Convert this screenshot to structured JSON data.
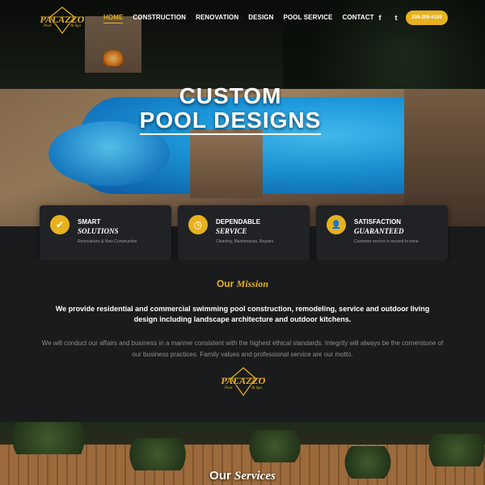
{
  "logo": {
    "name": "PALAZZO",
    "sub_left": "Pool",
    "sub_right": "& Spa"
  },
  "nav": {
    "items": [
      {
        "label": "HOME",
        "active": true
      },
      {
        "label": "CONSTRUCTION",
        "active": false
      },
      {
        "label": "RENOVATION",
        "active": false
      },
      {
        "label": "DESIGN",
        "active": false
      },
      {
        "label": "POOL SERVICE",
        "active": false
      },
      {
        "label": "CONTACT",
        "active": false
      }
    ],
    "social": [
      {
        "icon": "facebook-icon",
        "glyph": "f"
      },
      {
        "icon": "twitter-icon",
        "glyph": "t"
      }
    ],
    "phone": "239-205-6100"
  },
  "hero": {
    "line1": "CUSTOM",
    "line2": "POOL DESIGNS"
  },
  "features": [
    {
      "icon": "checkmark-icon",
      "glyph": "✔",
      "title": "SMART",
      "subtitle": "SOLUTIONS",
      "desc": "Renovations & New Construction"
    },
    {
      "icon": "clock-icon",
      "glyph": "◷",
      "title": "DEPENDABLE",
      "subtitle": "SERVICE",
      "desc": "Cleaning, Maintenance, Repairs."
    },
    {
      "icon": "user-plus-icon",
      "glyph": "👤",
      "title": "SATISFACTION",
      "subtitle": "GUARANTEED",
      "desc": "Customer service is second to none."
    }
  ],
  "mission": {
    "title_plain": "Our",
    "title_italic": "Mission",
    "lead": "We provide residential and commercial swimming pool construction, remodeling, service and outdoor living design including landscape architecture and outdoor kitchens.",
    "body": "We will conduct our affairs and business in a manner consistent with the highest ethical standards. Integrity will always be the cornerstone of our business practices. Family values and professional service are our motto."
  },
  "services": {
    "title_plain": "Our",
    "title_italic": "Services"
  },
  "colors": {
    "accent": "#e8b21e",
    "background": "#1a1b1d",
    "card": "#202226"
  }
}
